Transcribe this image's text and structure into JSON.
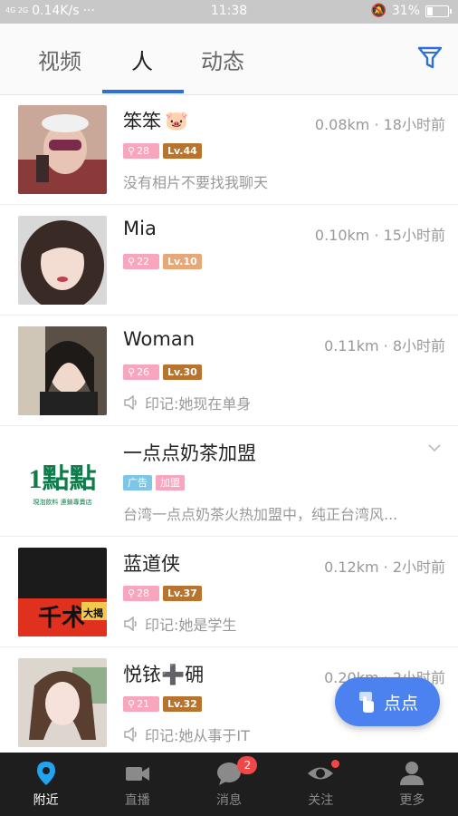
{
  "status_bar": {
    "signal": "4G 2G",
    "speed": "0.14K/s",
    "dots": "···",
    "time": "11:38",
    "battery": "31%"
  },
  "tabs": [
    {
      "label": "视频"
    },
    {
      "label": "人"
    },
    {
      "label": "动态"
    }
  ],
  "people": [
    {
      "name": "笨笨",
      "emoji": "🐷",
      "meta": "0.08km · 18小时前",
      "score": "28",
      "level": "Lv.44",
      "desc": "没有相片不要找我聊天",
      "desc_icon": "none"
    },
    {
      "name": "Mia",
      "emoji": "",
      "meta": "0.10km · 15小时前",
      "score": "22",
      "level": "Lv.10",
      "desc": "",
      "desc_icon": "none"
    },
    {
      "name": "Woman",
      "emoji": "",
      "meta": "0.11km · 8小时前",
      "score": "26",
      "level": "Lv.30",
      "desc": "印记:她现在单身",
      "desc_icon": "speaker-icon"
    },
    {
      "name": "一点点奶茶加盟",
      "emoji": "",
      "meta": "",
      "ad_label": "广告",
      "join_label": "加盟",
      "desc": "台湾一点点奶茶火热加盟中，纯正台湾风...",
      "desc_icon": "none"
    },
    {
      "name": "蓝道侠",
      "emoji": "",
      "meta": "0.12km · 2小时前",
      "score": "28",
      "level": "Lv.37",
      "desc": "印记:她是学生",
      "desc_icon": "speaker-icon"
    },
    {
      "name": "悦铱➕砽",
      "emoji": "",
      "meta": "0.20km · 2小时前",
      "score": "21",
      "level": "Lv.32",
      "desc": "印记:她从事于IT",
      "desc_icon": "speaker-icon"
    }
  ],
  "ad_logo": {
    "big": "1點點",
    "small": "現泡飲料 連鎖專賣店"
  },
  "poster_text": "千术",
  "poster_sub": "大揭",
  "fab": {
    "label": "点点"
  },
  "nav": [
    {
      "label": "附近"
    },
    {
      "label": "直播"
    },
    {
      "label": "消息",
      "badge": "2"
    },
    {
      "label": "关注"
    },
    {
      "label": "更多"
    }
  ],
  "colors": {
    "accent": "#2f6fd8",
    "fab": "#4c82f0",
    "badge_red": "#f04848",
    "level_brown": "#b8742e"
  }
}
